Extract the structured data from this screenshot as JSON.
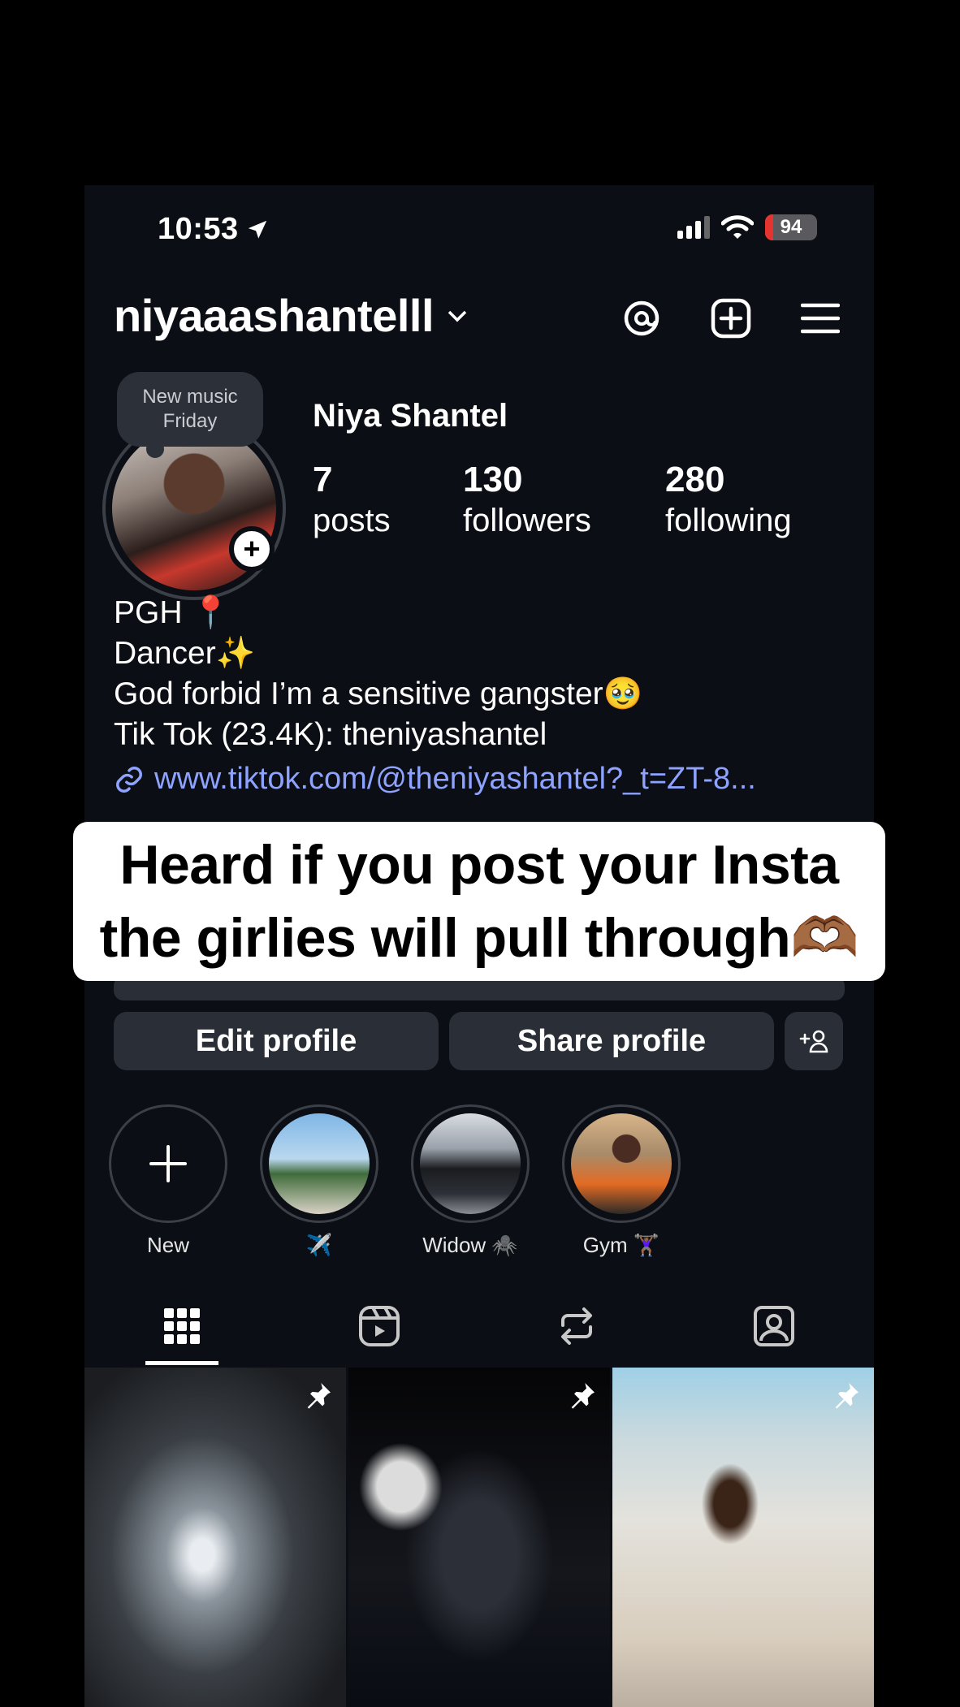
{
  "status_bar": {
    "time": "10:53",
    "battery": "94"
  },
  "header": {
    "username": "niyaaashantelll"
  },
  "note": {
    "line1": "New music",
    "line2": "Friday"
  },
  "profile": {
    "display_name": "Niya Shantel",
    "stats": [
      {
        "count": "7",
        "label": "posts"
      },
      {
        "count": "130",
        "label": "followers"
      },
      {
        "count": "280",
        "label": "following"
      }
    ]
  },
  "bio": {
    "lines": [
      "PGH 📍",
      "Dancer✨",
      "God forbid I’m a sensitive gangster🥹",
      "Tik Tok (23.4K): theniyashantel"
    ],
    "link": "www.tiktok.com/@theniyashantel?_t=ZT-8..."
  },
  "caption": {
    "line1": "Heard if you post your Insta",
    "line2": "the girlies will pull through🫶🏾"
  },
  "buttons": {
    "edit": "Edit profile",
    "share": "Share profile"
  },
  "highlights": [
    {
      "label": "New",
      "icon": "plus-icon"
    },
    {
      "label": "✈️",
      "icon": "photo"
    },
    {
      "label": "Widow 🕷️",
      "icon": "photo"
    },
    {
      "label": "Gym 🏋🏾‍♀️",
      "icon": "photo"
    }
  ],
  "tabs": [
    "grid-icon",
    "reels-icon",
    "reposts-icon",
    "tagged-icon"
  ],
  "colors": {
    "background": "#0b0e14",
    "link": "#8ea3ff",
    "button": "#2a2e36"
  }
}
